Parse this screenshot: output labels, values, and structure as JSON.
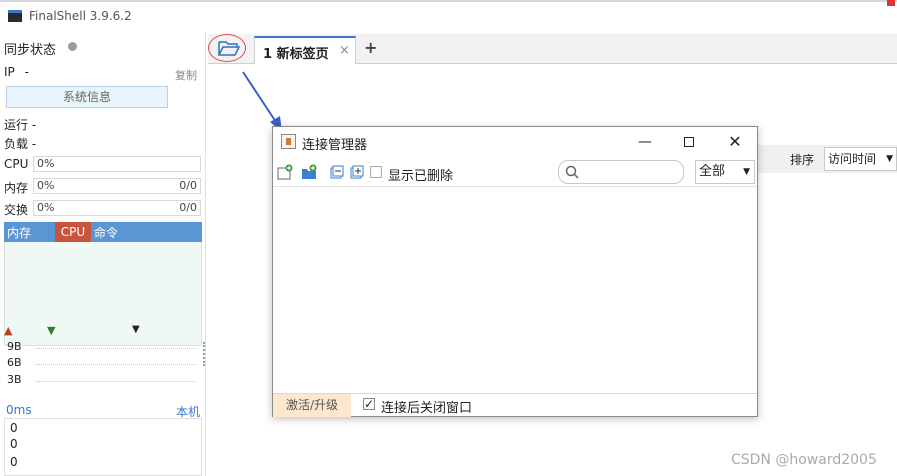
{
  "window": {
    "title": "FinalShell 3.9.6.2"
  },
  "sidebar": {
    "sync_status": "同步状态",
    "ip_label": "IP",
    "ip_value": "-",
    "copy": "复制",
    "sysinfo_button": "系统信息",
    "run_label": "运行",
    "run_value": "-",
    "load_label": "负载",
    "load_value": "-",
    "cpu": {
      "label": "CPU",
      "value": "0%"
    },
    "mem": {
      "label": "内存",
      "value": "0%",
      "amount": "0/0"
    },
    "swap": {
      "label": "交换",
      "value": "0%",
      "amount": "0/0"
    },
    "process_headers": [
      "内存",
      "CPU",
      "命令"
    ],
    "net_labels": [
      "9B",
      "6B",
      "3B"
    ],
    "ping": {
      "label": "0ms",
      "host": "本机",
      "values": [
        "0",
        "0",
        "0"
      ]
    }
  },
  "tabs": [
    {
      "label": "1 新标签页",
      "close": "×"
    }
  ],
  "tab_add": "+",
  "sort": {
    "label": "排序",
    "value": "访问时间"
  },
  "dialog": {
    "title": "连接管理器",
    "show_deleted": "显示已删除",
    "search_placeholder": "",
    "filter_value": "全部",
    "activate": "激活/升级",
    "close_after_connect": "连接后关闭窗口",
    "close_after_checked": true
  },
  "watermark": "CSDN @howard2005",
  "colors": {
    "accent": "#3a78c9",
    "cpu_header": "#c9533c",
    "proc_header": "#5b96d4",
    "highlight_circle": "#e04848"
  },
  "icons": [
    "folder-open-icon",
    "new-connection-icon",
    "new-folder-icon",
    "collapse-icon",
    "expand-icon",
    "search-icon",
    "app-icon"
  ]
}
